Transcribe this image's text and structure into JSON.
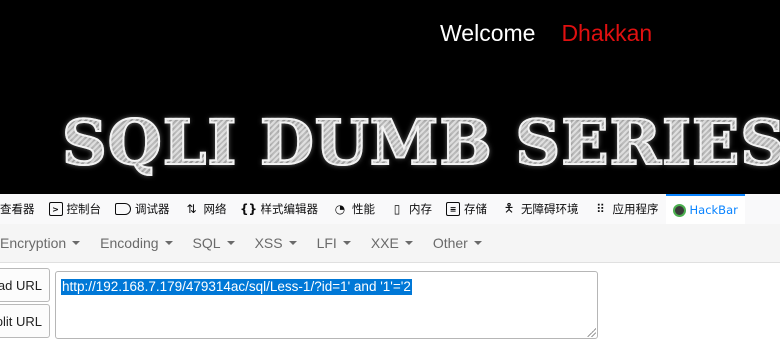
{
  "page": {
    "welcome_label": "Welcome",
    "user_name": "Dhakkan",
    "banner_title": "SQLI DUMB SERIES"
  },
  "devtools": {
    "tabs": [
      {
        "label": "查看器",
        "icon": "inspector-icon"
      },
      {
        "label": "控制台",
        "icon": "console-icon"
      },
      {
        "label": "调试器",
        "icon": "debugger-icon"
      },
      {
        "label": "网络",
        "icon": "network-icon"
      },
      {
        "label": "样式编辑器",
        "icon": "style-editor-icon"
      },
      {
        "label": "性能",
        "icon": "performance-icon"
      },
      {
        "label": "内存",
        "icon": "memory-icon"
      },
      {
        "label": "存储",
        "icon": "storage-icon"
      },
      {
        "label": "无障碍环境",
        "icon": "accessibility-icon"
      },
      {
        "label": "应用程序",
        "icon": "application-icon"
      },
      {
        "label": "HackBar",
        "icon": "hackbar-icon"
      }
    ],
    "active_tab": "HackBar"
  },
  "hackbar": {
    "menus": [
      "Encryption",
      "Encoding",
      "SQL",
      "XSS",
      "LFI",
      "XXE",
      "Other"
    ],
    "load_url_label": "Load URL",
    "split_url_label": "Split URL",
    "url_value": "http://192.168.7.179/479314ac/sql/Less-1/?id=1' and '1'='2"
  },
  "colors": {
    "welcome": "#ffffff",
    "user_name": "#e01010",
    "selection": "#0078d7",
    "active_tab": "#0a84ff"
  }
}
